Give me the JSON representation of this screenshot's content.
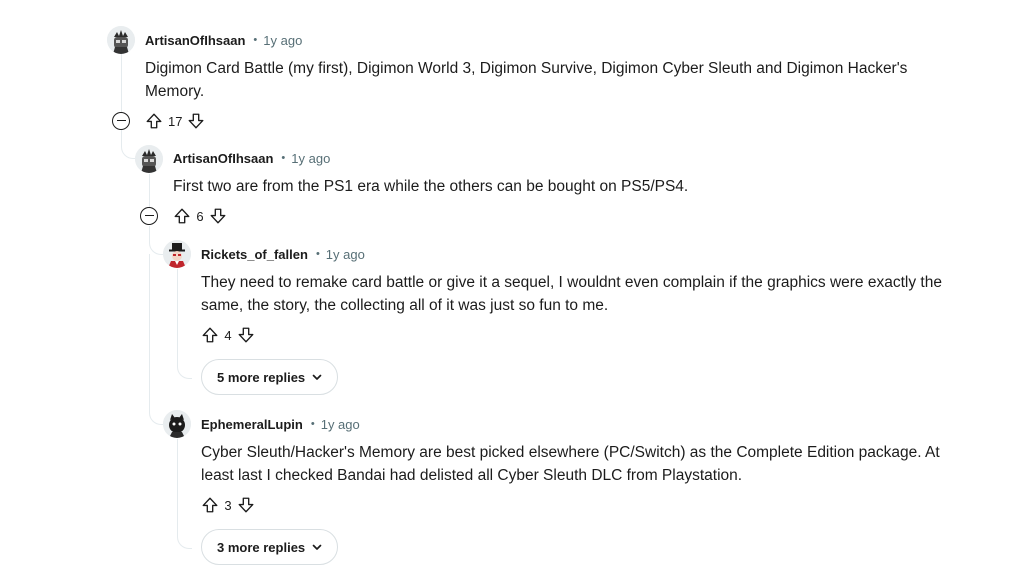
{
  "comments": [
    {
      "author": "ArtisanOfIhsaan",
      "separator": "•",
      "time": "1y ago",
      "body": "Digimon Card Battle (my first), Digimon World 3, Digimon Survive, Digimon Cyber Sleuth and Digimon Hacker's Memory.",
      "score": "17",
      "avatar_icon": "robot-avatar-icon"
    },
    {
      "author": "ArtisanOfIhsaan",
      "separator": "•",
      "time": "1y ago",
      "body": "First two are from the PS1 era while the others can be bought on PS5/PS4.",
      "score": "6",
      "avatar_icon": "robot-avatar-icon"
    },
    {
      "author": "Rickets_of_fallen",
      "separator": "•",
      "time": "1y ago",
      "body": "They need to remake card battle or give it a sequel, I wouldnt even complain if the graphics were exactly the same, the story, the collecting all of it was just so fun to me.",
      "score": "4",
      "avatar_icon": "top-hat-avatar-icon",
      "more_replies": "5 more replies"
    },
    {
      "author": "EphemeralLupin",
      "separator": "•",
      "time": "1y ago",
      "body": "Cyber Sleuth/Hacker's Memory are best picked elsewhere (PC/Switch) as the Complete Edition package. At least last I checked Bandai had delisted all Cyber Sleuth DLC from Playstation.",
      "score": "3",
      "avatar_icon": "wolf-avatar-icon",
      "more_replies": "3 more replies"
    }
  ],
  "colors": {
    "text": "#1c1c1c",
    "muted": "#576f76",
    "thread_line": "#e5ebee",
    "button_border": "#d9dfe2"
  }
}
